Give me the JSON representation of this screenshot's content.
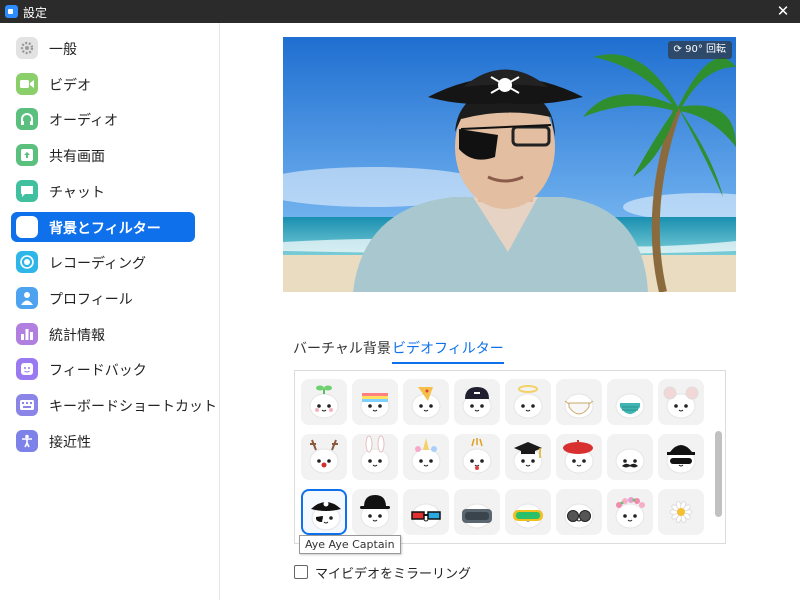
{
  "window": {
    "title": "設定",
    "close_glyph": "✕"
  },
  "sidebar": {
    "items": [
      {
        "label": "一般",
        "icon": "gear-icon",
        "color": "#e3e3e3",
        "active": false
      },
      {
        "label": "ビデオ",
        "icon": "video-camera-icon",
        "color": "#8bcf6b",
        "active": false
      },
      {
        "label": "オーディオ",
        "icon": "headphones-icon",
        "color": "#5bbf7e",
        "active": false
      },
      {
        "label": "共有画面",
        "icon": "share-screen-icon",
        "color": "#5bbf7e",
        "active": false
      },
      {
        "label": "チャット",
        "icon": "chat-bubble-icon",
        "color": "#41c0a0",
        "active": false
      },
      {
        "label": "背景とフィルター",
        "icon": "person-card-icon",
        "color": "#2d8cff",
        "active": true
      },
      {
        "label": "レコーディング",
        "icon": "record-icon",
        "color": "#2fb6e8",
        "active": false
      },
      {
        "label": "プロフィール",
        "icon": "person-icon",
        "color": "#4da3f0",
        "active": false
      },
      {
        "label": "統計情報",
        "icon": "bar-chart-icon",
        "color": "#b07fe0",
        "active": false
      },
      {
        "label": "フィードバック",
        "icon": "smiley-icon",
        "color": "#9a7af0",
        "active": false
      },
      {
        "label": "キーボードショートカット",
        "icon": "keyboard-icon",
        "color": "#8a85e6",
        "active": false
      },
      {
        "label": "接近性",
        "icon": "accessibility-icon",
        "color": "#7e82e8",
        "active": false
      }
    ]
  },
  "preview": {
    "rotate_label": "90° 回転"
  },
  "tabs": {
    "virtual_background": "バーチャル背景",
    "video_filter": "ビデオフィルター",
    "active": "video_filter"
  },
  "filters": [
    "sprout",
    "rainbow",
    "pizza",
    "cap",
    "halo",
    "mask-white",
    "mask-teal",
    "mouse",
    "reindeer",
    "bunny",
    "unicorn",
    "party",
    "graduation",
    "beret",
    "mustache",
    "bandit",
    "pirate",
    "bowler",
    "3d-glasses",
    "vr-headset",
    "ski-goggles",
    "round-glasses",
    "flower-crown",
    "daisy"
  ],
  "selected_filter": "pirate",
  "tooltip": "Aye Aye Captain",
  "mirror": {
    "label": "マイビデオをミラーリング",
    "checked": false
  }
}
